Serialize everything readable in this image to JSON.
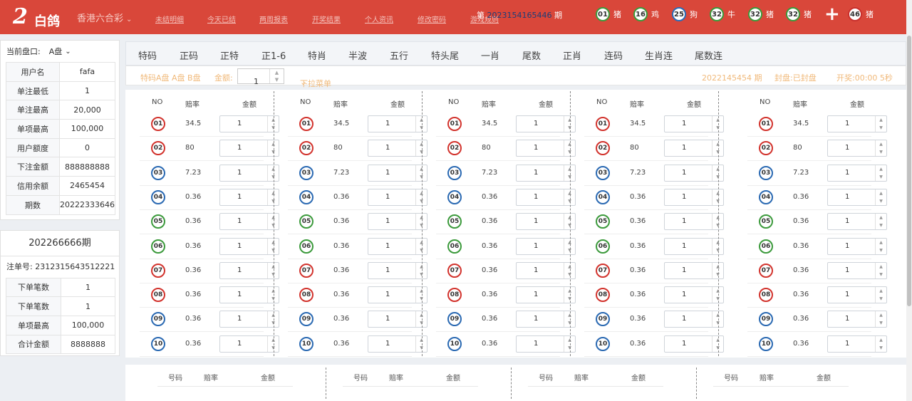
{
  "header": {
    "logo_text": "白鸽",
    "lottery_select": "香港六合彩",
    "nav": [
      "未结明细",
      "今天已结",
      "两周报表",
      "开奖结果",
      "个人资讯",
      "修改密码",
      "游戏规则"
    ],
    "issue_prefix": "第",
    "issue_no": "2023154165446",
    "issue_suffix": "期",
    "draw_balls": [
      {
        "num": "01",
        "zodiac": "猪",
        "color": "green"
      },
      {
        "num": "16",
        "zodiac": "鸡",
        "color": "green"
      },
      {
        "num": "25",
        "zodiac": "狗",
        "color": "blue"
      },
      {
        "num": "32",
        "zodiac": "牛",
        "color": "green"
      },
      {
        "num": "32",
        "zodiac": "猪",
        "color": "green"
      },
      {
        "num": "32",
        "zodiac": "猪",
        "color": "green"
      },
      {
        "num": "46",
        "zodiac": "猪",
        "color": "red"
      }
    ],
    "plus_symbol": "+"
  },
  "left": {
    "pan_label": "当前盘口:",
    "pan_value": "A盘",
    "info": [
      {
        "k": "用户名",
        "v": "fafa"
      },
      {
        "k": "单注最低",
        "v": "1"
      },
      {
        "k": "单注最高",
        "v": "20,000"
      },
      {
        "k": "单项最高",
        "v": "100,000"
      },
      {
        "k": "用户额度",
        "v": "0"
      },
      {
        "k": "下注金额",
        "v": "888888888"
      },
      {
        "k": "信用余额",
        "v": "2465454"
      },
      {
        "k": "期数",
        "v": "20222333646"
      }
    ],
    "period_title": "202266666期",
    "bet_no_label": "注单号:",
    "bet_no": "2312315643512221",
    "summary": [
      {
        "k": "下单笔数",
        "v": "1"
      },
      {
        "k": "下单笔数",
        "v": "1"
      },
      {
        "k": "单项最高",
        "v": "100,000"
      },
      {
        "k": "合计金额",
        "v": "8888888"
      }
    ]
  },
  "tabs": [
    "特码",
    "正码",
    "正特",
    "正1-6",
    "特肖",
    "半波",
    "五行",
    "特头尾",
    "一肖",
    "尾数",
    "正肖",
    "连码",
    "生肖连",
    "尾数连"
  ],
  "subbar": {
    "title": "特码A盘 A盘 B盘",
    "amount_label": "金额:",
    "amount_value": "1",
    "dropdown": "下拉菜单",
    "issue": "2022145454 期",
    "status": "封盘:已封盘",
    "countdown": "开奖:00:00 5秒"
  },
  "grid": {
    "headers": {
      "no": "NO",
      "odds": "赔率",
      "amount": "金额"
    },
    "rows": [
      {
        "num": "01",
        "odds": "34.5",
        "amount": "1",
        "color": "red"
      },
      {
        "num": "02",
        "odds": "80",
        "amount": "1",
        "color": "red"
      },
      {
        "num": "03",
        "odds": "7.23",
        "amount": "1",
        "color": "blue"
      },
      {
        "num": "04",
        "odds": "0.36",
        "amount": "1",
        "color": "blue"
      },
      {
        "num": "05",
        "odds": "0.36",
        "amount": "1",
        "color": "green"
      },
      {
        "num": "06",
        "odds": "0.36",
        "amount": "1",
        "color": "green"
      },
      {
        "num": "07",
        "odds": "0.36",
        "amount": "1",
        "color": "red"
      },
      {
        "num": "08",
        "odds": "0.36",
        "amount": "1",
        "color": "red"
      },
      {
        "num": "09",
        "odds": "0.36",
        "amount": "1",
        "color": "blue"
      },
      {
        "num": "10",
        "odds": "0.36",
        "amount": "1",
        "color": "blue"
      }
    ]
  },
  "bottom": {
    "headers": [
      "号码",
      "赔率",
      "金额"
    ]
  }
}
